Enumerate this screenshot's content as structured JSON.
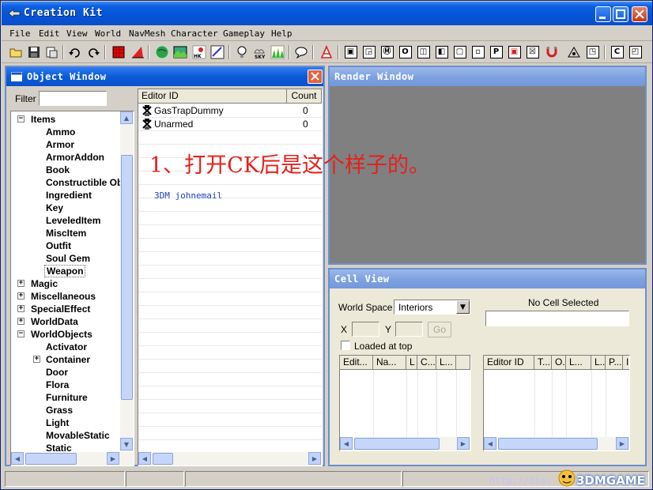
{
  "app": {
    "title": "Creation Kit",
    "menu": [
      "File",
      "Edit",
      "View",
      "World",
      "NavMesh",
      "Character",
      "Gameplay",
      "Help"
    ]
  },
  "object_window": {
    "title": "Object Window",
    "filter_label": "Filter",
    "filter_value": "",
    "tree": [
      {
        "label": "Items",
        "expander": "minus",
        "level": 0
      },
      {
        "label": "Ammo",
        "level": 1
      },
      {
        "label": "Armor",
        "level": 1
      },
      {
        "label": "ArmorAddon",
        "level": 1
      },
      {
        "label": "Book",
        "level": 1
      },
      {
        "label": "Constructible Ob",
        "level": 1
      },
      {
        "label": "Ingredient",
        "level": 1
      },
      {
        "label": "Key",
        "level": 1
      },
      {
        "label": "LeveledItem",
        "level": 1
      },
      {
        "label": "MiscItem",
        "level": 1
      },
      {
        "label": "Outfit",
        "level": 1
      },
      {
        "label": "Soul Gem",
        "level": 1
      },
      {
        "label": "Weapon",
        "level": 1,
        "selected": true
      },
      {
        "label": "Magic",
        "expander": "plus",
        "level": 0
      },
      {
        "label": "Miscellaneous",
        "expander": "plus",
        "level": 0
      },
      {
        "label": "SpecialEffect",
        "expander": "plus",
        "level": 0
      },
      {
        "label": "WorldData",
        "expander": "plus",
        "level": 0
      },
      {
        "label": "WorldObjects",
        "expander": "minus",
        "level": 0
      },
      {
        "label": "Activator",
        "level": 1
      },
      {
        "label": "Container",
        "expander": "plus",
        "level": 1
      },
      {
        "label": "Door",
        "level": 1
      },
      {
        "label": "Flora",
        "level": 1
      },
      {
        "label": "Furniture",
        "level": 1
      },
      {
        "label": "Grass",
        "level": 1
      },
      {
        "label": "Light",
        "level": 1
      },
      {
        "label": "MovableStatic",
        "level": 1
      },
      {
        "label": "Static",
        "level": 1
      }
    ],
    "list_headers": [
      "Editor ID",
      "Count"
    ],
    "list_rows": [
      {
        "editor_id": "GasTrapDummy",
        "count": "0"
      },
      {
        "editor_id": "Unarmed",
        "count": "0"
      }
    ]
  },
  "annotation": {
    "caption": "1、打开CK后是这个样子的。",
    "credit": "3DM johnemail"
  },
  "render_window": {
    "title": "Render Window"
  },
  "cell_view": {
    "title": "Cell View",
    "world_space_label": "World Space",
    "world_space_value": "Interiors",
    "x_label": "X",
    "y_label": "Y",
    "go_label": "Go",
    "no_cell_label": "No Cell Selected",
    "loaded_at_top_label": "Loaded at top",
    "left_headers": [
      "Edit...",
      "Na...",
      "L",
      "C...",
      "L..."
    ],
    "right_headers": [
      "Editor ID",
      "T...",
      "O...",
      "L...",
      "L...",
      "P...",
      "I"
    ]
  },
  "watermark": {
    "url_text": "http://bbs.",
    "brand": "3DMGAME"
  },
  "colors": {
    "titlebar": "#0454d8",
    "subwin_title": "#7fa2e0",
    "caption_red": "#e4211b",
    "credit_blue": "#1f3fbf",
    "render_gray": "#808080"
  }
}
